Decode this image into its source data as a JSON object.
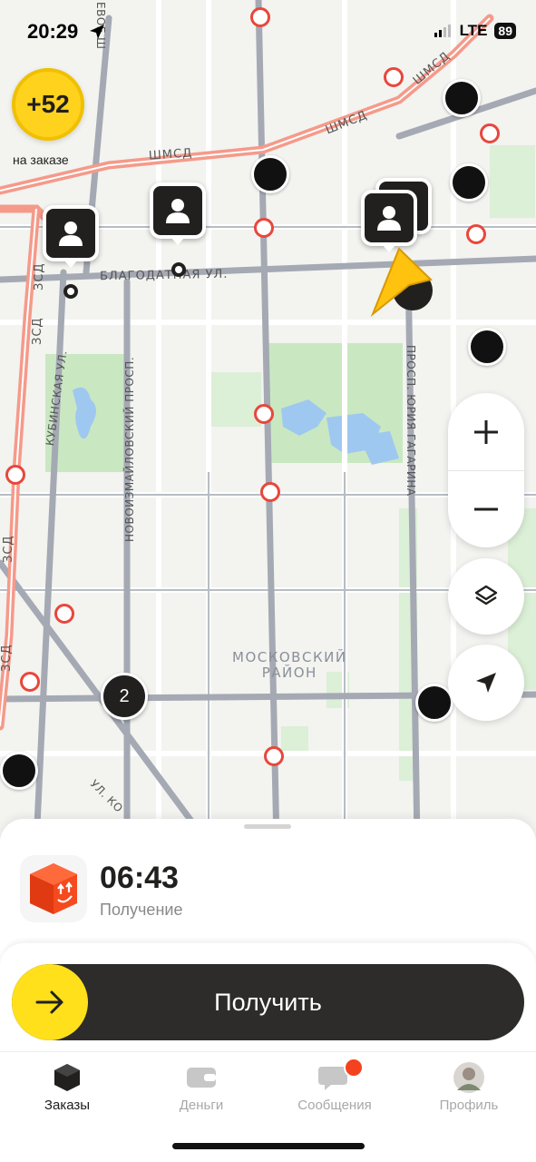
{
  "status_bar": {
    "time": "20:29",
    "network": "LTE",
    "battery": "89"
  },
  "bonus": {
    "value": "+52",
    "label": "на заказе"
  },
  "map": {
    "labels": {
      "shmsd_1": "ШМСД",
      "shmsd_2": "ШМСД",
      "shmsd_3": "ШМСД",
      "blagodatnaya": "БЛАГОДАТНАЯ УЛ.",
      "kubinskaya": "КУБИНСКАЯ УЛ.",
      "novoizmailovsky": "НОВОИЗМАЙЛОВСКИЙ ПРОСП.",
      "gagarina": "ПРОСП. ЮРИЯ ГАГАРИНА",
      "zsd_1": "ЗСД",
      "zsd_2": "ЗСД",
      "zsd_3": "ЗСД",
      "zsd_4": "ЗСД",
      "district_1": "МОСКОВСКИЙ",
      "district_2": "РАЙОН",
      "ul_ko": "УЛ. КО",
      "partial_label": "ЕВОЕ Ш"
    },
    "cluster_count": "2"
  },
  "order": {
    "time": "06:43",
    "status": "Получение"
  },
  "slider": {
    "label": "Получить"
  },
  "tabs": [
    {
      "label": "Заказы",
      "icon": "orders-box-icon",
      "active": true
    },
    {
      "label": "Деньги",
      "icon": "wallet-icon",
      "active": false
    },
    {
      "label": "Сообщения",
      "icon": "chat-icon",
      "active": false
    },
    {
      "label": "Профиль",
      "icon": "avatar-icon",
      "active": false
    }
  ],
  "colors": {
    "accent_yellow": "#ffe01a",
    "brand_orange": "#f5491e",
    "map_green": "#c9e8c2",
    "water": "#9fc8f0",
    "highway": "#f59a8a"
  }
}
